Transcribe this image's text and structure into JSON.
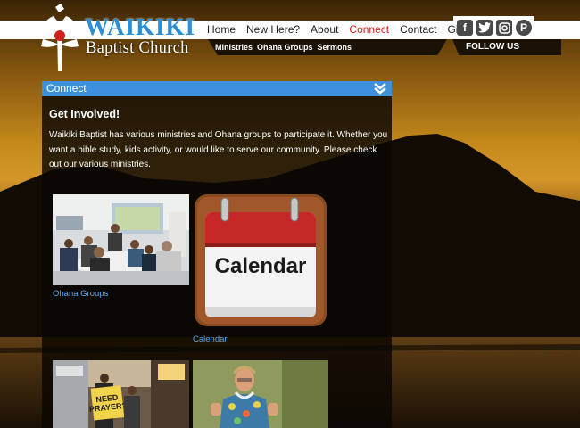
{
  "site": {
    "name_line1": "WAIKIKI",
    "name_line2": "Baptist Church"
  },
  "nav": {
    "items": [
      "Home",
      "New Here?",
      "About",
      "Connect",
      "Contact",
      "Give"
    ],
    "active": "Connect",
    "sub_items": [
      "Ministries",
      "Ohana Groups",
      "Sermons"
    ]
  },
  "social": {
    "icons": [
      "facebook-icon",
      "twitter-icon",
      "instagram-icon",
      "pinterest-icon"
    ],
    "follow_label": "FOLLOW US"
  },
  "panel": {
    "title": "Connect",
    "heading": "Get Involved!",
    "intro": "Waikiki Baptist has various ministries and Ohana groups to participate it. Whether you want a bible study, kids activity, or would like to serve our community. Please check out our various ministries."
  },
  "tiles": {
    "ohana_label": "Ohana Groups",
    "calendar_label": "Calendar",
    "calendar_icon_text": "Calendar",
    "sign_text": "NEED PRAYER?"
  },
  "colors": {
    "accent_blue": "#3d90dc",
    "nav_active": "#d0211b",
    "link_blue": "#5aa7ef"
  }
}
